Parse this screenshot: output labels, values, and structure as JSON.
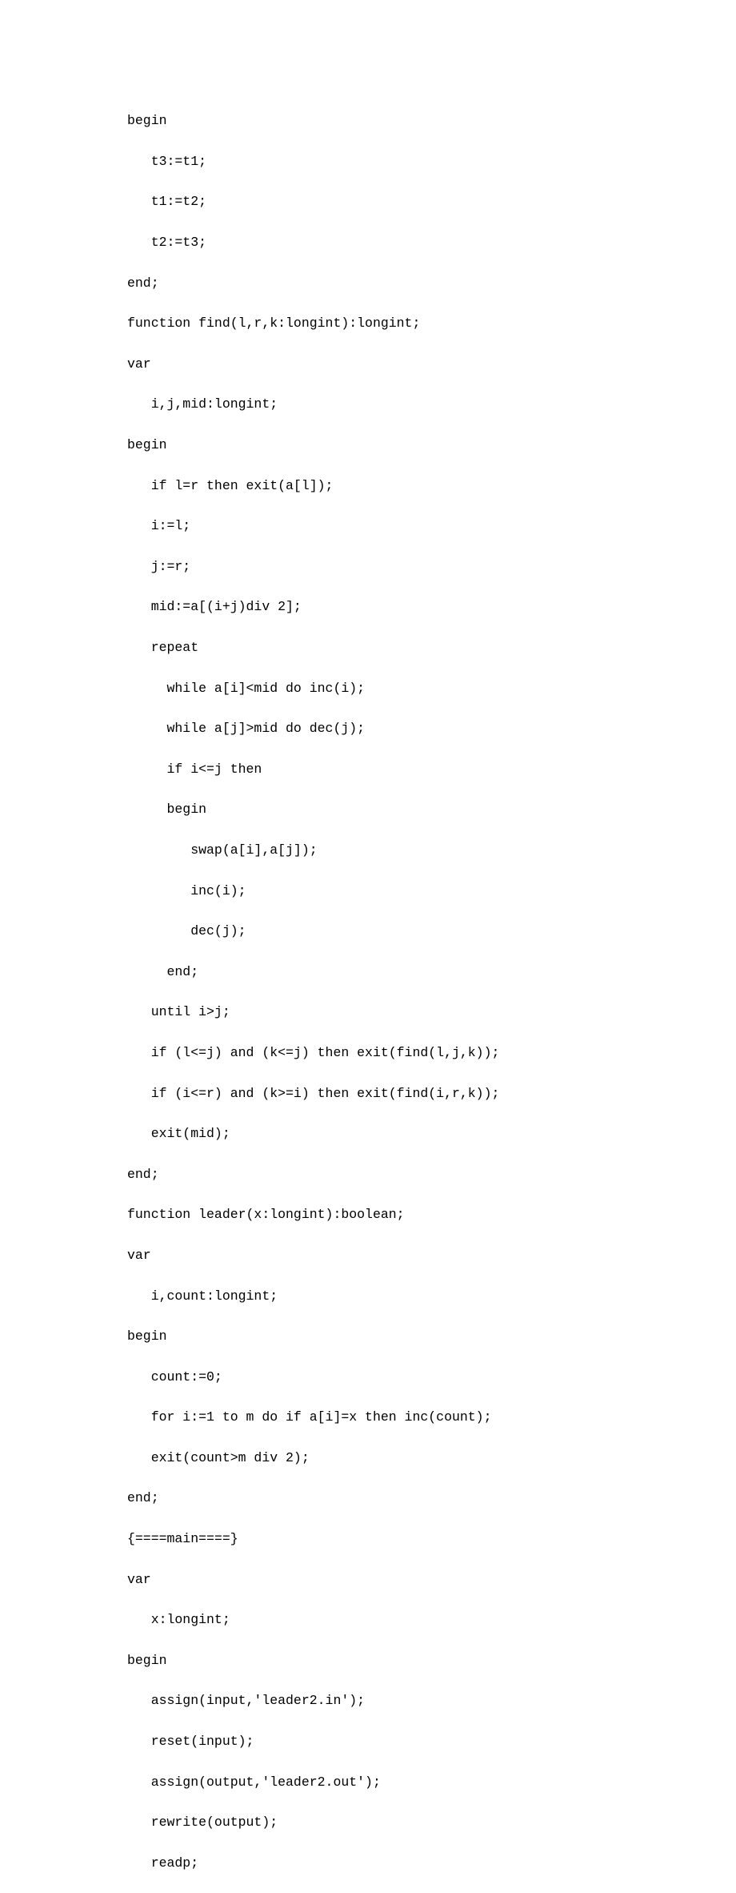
{
  "code": {
    "lines": [
      "begin",
      "   t3:=t1;",
      "   t1:=t2;",
      "   t2:=t3;",
      "end;",
      "function find(l,r,k:longint):longint;",
      "var",
      "   i,j,mid:longint;",
      "begin",
      "   if l=r then exit(a[l]);",
      "   i:=l;",
      "   j:=r;",
      "   mid:=a[(i+j)div 2];",
      "   repeat",
      "     while a[i]<mid do inc(i);",
      "     while a[j]>mid do dec(j);",
      "     if i<=j then",
      "     begin",
      "        swap(a[i],a[j]);",
      "        inc(i);",
      "        dec(j);",
      "     end;",
      "   until i>j;",
      "   if (l<=j) and (k<=j) then exit(find(l,j,k));",
      "   if (i<=r) and (k>=i) then exit(find(i,r,k));",
      "   exit(mid);",
      "end;",
      "function leader(x:longint):boolean;",
      "var",
      "   i,count:longint;",
      "begin",
      "   count:=0;",
      "   for i:=1 to m do if a[i]=x then inc(count);",
      "   exit(count>m div 2);",
      "end;",
      "{====main====}",
      "var",
      "   x:longint;",
      "begin",
      "   assign(input,'leader2.in');",
      "   reset(input);",
      "   assign(output,'leader2.out');",
      "   rewrite(output);",
      "   readp;"
    ]
  }
}
